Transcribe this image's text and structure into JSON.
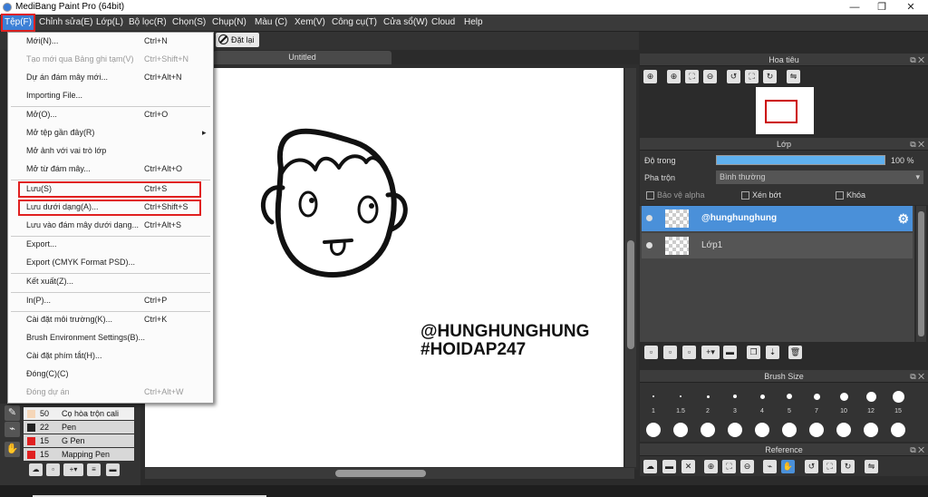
{
  "titlebar": {
    "title": "MediBang Paint Pro (64bit)",
    "minimize": "—",
    "restore": "❐",
    "close": "✕"
  },
  "menubar": [
    "Tệp(F)",
    "Chỉnh sửa(E)",
    "Lớp(L)",
    "Bộ lọc(R)",
    "Chọn(S)",
    "Chụp(N)",
    "Màu (C)",
    "Xem(V)",
    "Công cụ(T)",
    "Cửa sổ(W)",
    "Cloud",
    "Help"
  ],
  "toolbar": {
    "reset_label": "Đặt lại"
  },
  "document": {
    "tab": "Untitled"
  },
  "canvas": {
    "text_line1": "@HUNGHUNGHUNG",
    "text_line2": "#HOIDAP247"
  },
  "file_menu": [
    {
      "label": "Mới(N)...",
      "shortcut": "Ctrl+N",
      "disabled": false
    },
    {
      "label": "Tạo mới qua Bảng ghi tạm(V)",
      "shortcut": "Ctrl+Shift+N",
      "disabled": true
    },
    {
      "label": "Dự án đám mây mới...",
      "shortcut": "Ctrl+Alt+N",
      "disabled": false
    },
    {
      "label": "Importing File...",
      "shortcut": "",
      "disabled": false
    },
    {
      "label": "Mở(O)...",
      "shortcut": "Ctrl+O",
      "disabled": false
    },
    {
      "label": "Mở tệp gần đây(R)",
      "shortcut": "",
      "disabled": false,
      "submenu": true
    },
    {
      "label": "Mở ảnh với vai trò lớp",
      "shortcut": "",
      "disabled": false
    },
    {
      "label": "Mở từ đám mây...",
      "shortcut": "Ctrl+Alt+O",
      "disabled": false
    },
    {
      "label": "Lưu(S)",
      "shortcut": "Ctrl+S",
      "disabled": false,
      "highlighted": true
    },
    {
      "label": "Lưu dưới dạng(A)...",
      "shortcut": "Ctrl+Shift+S",
      "disabled": false,
      "highlighted": true
    },
    {
      "label": "Lưu vào đám mây dưới dạng...",
      "shortcut": "Ctrl+Alt+S",
      "disabled": false
    },
    {
      "label": "Export...",
      "shortcut": "",
      "disabled": false
    },
    {
      "label": "Export (CMYK Format PSD)...",
      "shortcut": "",
      "disabled": false
    },
    {
      "label": "Kết xuất(Z)...",
      "shortcut": "",
      "disabled": false
    },
    {
      "label": "In(P)...",
      "shortcut": "Ctrl+P",
      "disabled": false
    },
    {
      "label": "Cài đặt môi trường(K)...",
      "shortcut": "Ctrl+K",
      "disabled": false
    },
    {
      "label": "Brush Environment Settings(B)...",
      "shortcut": "",
      "disabled": false
    },
    {
      "label": "Cài đặt phím tắt(H)...",
      "shortcut": "",
      "disabled": false
    },
    {
      "label": "Đóng(C)(C)",
      "shortcut": "",
      "disabled": false
    },
    {
      "label": "Đóng dự án",
      "shortcut": "Ctrl+Alt+W",
      "disabled": true
    }
  ],
  "brushes": [
    {
      "size": "50",
      "name": "Cọ hòa trộn cali",
      "color": "#f5d6b8",
      "selected": true
    },
    {
      "size": "22",
      "name": "Pen",
      "color": "#222222",
      "selected": false
    },
    {
      "size": "15",
      "name": "G Pen",
      "color": "#e02020",
      "selected": false
    },
    {
      "size": "15",
      "name": "Mapping Pen",
      "color": "#e02020",
      "selected": false
    }
  ],
  "navigator": {
    "title": "Hoa tiêu"
  },
  "layer_panel": {
    "title": "Lớp",
    "opacity_label": "Độ trong",
    "opacity_value": "100 %",
    "opacity_percent": 100,
    "blend_label": "Pha trộn",
    "blend_value": "Bình thường",
    "protect_alpha": "Bảo vệ alpha",
    "clipping": "Xén bớt",
    "lock": "Khóa",
    "layers": [
      {
        "name": "@hunghunghung",
        "selected": true
      },
      {
        "name": "Lớp1",
        "selected": false
      }
    ]
  },
  "brush_size_panel": {
    "title": "Brush Size",
    "sizes": [
      "1",
      "1.5",
      "2",
      "3",
      "4",
      "5",
      "7",
      "10",
      "12",
      "15"
    ]
  },
  "reference_panel": {
    "title": "Reference"
  },
  "colors": {
    "accent": "#3c7fd6",
    "highlight": "#e02020",
    "layer_selected": "#4a90d9"
  }
}
